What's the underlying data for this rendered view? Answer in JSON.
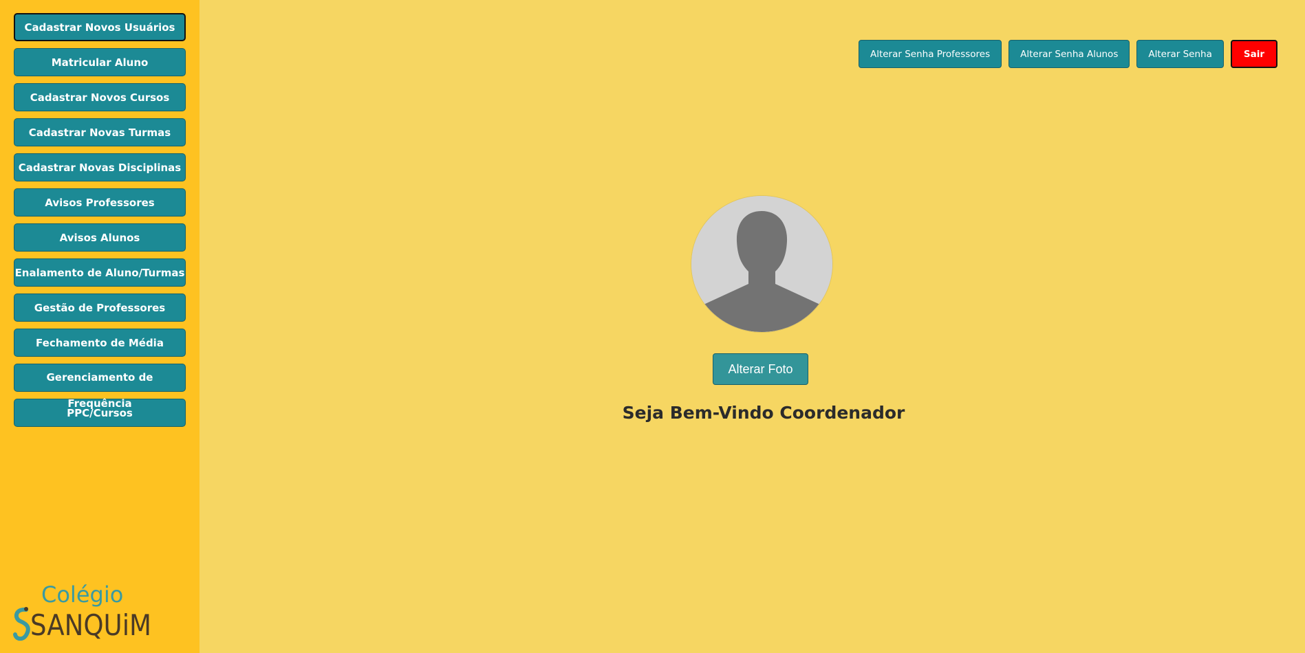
{
  "sidebar": {
    "items": [
      {
        "label": "Cadastrar Novos Usuários",
        "active": true
      },
      {
        "label": "Matricular Aluno"
      },
      {
        "label": "Cadastrar Novos Cursos"
      },
      {
        "label": "Cadastrar Novas Turmas"
      },
      {
        "label": "Cadastrar Novas Disciplinas"
      },
      {
        "label": "Avisos Professores"
      },
      {
        "label": "Avisos Alunos"
      },
      {
        "label": "Enalamento de Aluno/Turmas"
      },
      {
        "label": "Gestão de Professores"
      },
      {
        "label": "Fechamento de Média"
      },
      {
        "label": "Gerenciamento de Frequência"
      },
      {
        "label": "PPC/Cursos"
      }
    ],
    "logo": {
      "line1": "Colégio",
      "line2": "SANQUiM"
    }
  },
  "header": {
    "buttons": [
      {
        "label": "Alterar Senha Professores"
      },
      {
        "label": "Alterar Senha Alunos"
      },
      {
        "label": "Alterar Senha"
      }
    ],
    "logout_label": "Sair"
  },
  "main": {
    "avatar_icon": "user-placeholder-icon",
    "change_photo_label": "Alterar Foto",
    "welcome_text": "Seja Bem-Vindo Coordenador"
  },
  "colors": {
    "page_bg": "#f6d662",
    "sidebar_bg": "#fec221",
    "button_teal": "#1c8a95",
    "logout_red": "#ff0000",
    "logo_teal": "#3a9aa1",
    "logo_brown": "#4a3a26"
  }
}
